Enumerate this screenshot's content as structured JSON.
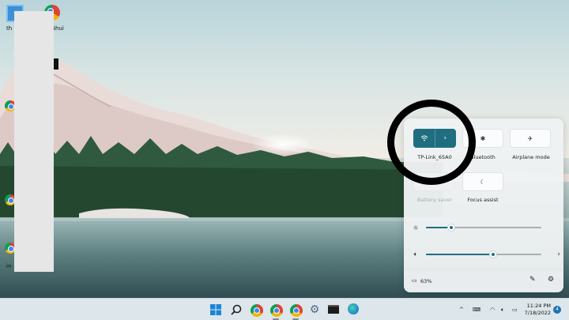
{
  "desktop": {
    "icons": [
      {
        "name": "desktop-folder-icon",
        "label": "th"
      },
      {
        "name": "chrome-desktop-icon",
        "label": "dl Ghui"
      },
      {
        "name": "chrome-desktop-icon-2",
        "label": "in"
      }
    ]
  },
  "quick_settings": {
    "wifi": {
      "label": "TP-Link_65A0",
      "state": "on"
    },
    "bluetooth": {
      "label": "Bluetooth"
    },
    "airplane": {
      "label": "Airplane mode"
    },
    "battery_saver": {
      "label": "Battery saver"
    },
    "focus_assist": {
      "label": "Focus assist"
    },
    "brightness": {
      "value": 0.22
    },
    "volume": {
      "value": 0.58
    },
    "battery": {
      "percent": "63%"
    },
    "accent_color": "#1f6e80"
  },
  "taskbar": {
    "apps": [
      "windows-start-icon",
      "search-icon",
      "chrome-icon",
      "chrome-profile-icon",
      "chrome-profile-icon-2",
      "settings-icon",
      "terminal-icon",
      "edge-icon"
    ],
    "tray_chevron": "^",
    "time": "11:24 PM",
    "date": "7/18/2022",
    "notifications": "4"
  }
}
